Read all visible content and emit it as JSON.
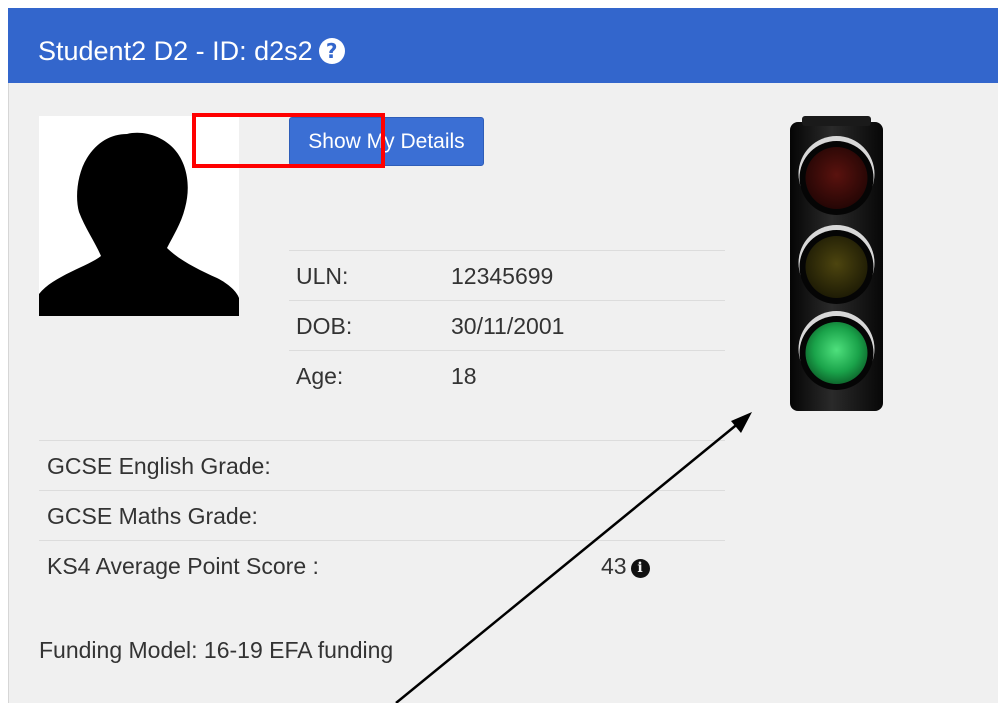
{
  "header": {
    "title": "Student2 D2 - ID: d2s2",
    "help_icon": "?"
  },
  "avatar": {
    "icon": "person-silhouette-icon"
  },
  "actions": {
    "show_details_label": "Show My Details"
  },
  "details": [
    {
      "label": "ULN:",
      "value": "12345699"
    },
    {
      "label": "DOB:",
      "value": "30/11/2001"
    },
    {
      "label": "Age:",
      "value": "18"
    }
  ],
  "grades": [
    {
      "label": "GCSE English Grade:",
      "value": ""
    },
    {
      "label": "GCSE Maths Grade:",
      "value": ""
    },
    {
      "label": "KS4 Average Point Score :",
      "value": "43",
      "info_icon": "i"
    }
  ],
  "funding": {
    "text": "Funding Model: 16-19 EFA funding"
  },
  "traffic_light": {
    "active": "green",
    "colors": {
      "red": "#3a0a08",
      "amber": "#2e2a08",
      "green": "#1aa34a"
    }
  },
  "colors": {
    "header": "#3366cc",
    "panel": "#f0f0f0",
    "button": "#3b6fd4",
    "highlight": "#ff0000"
  }
}
